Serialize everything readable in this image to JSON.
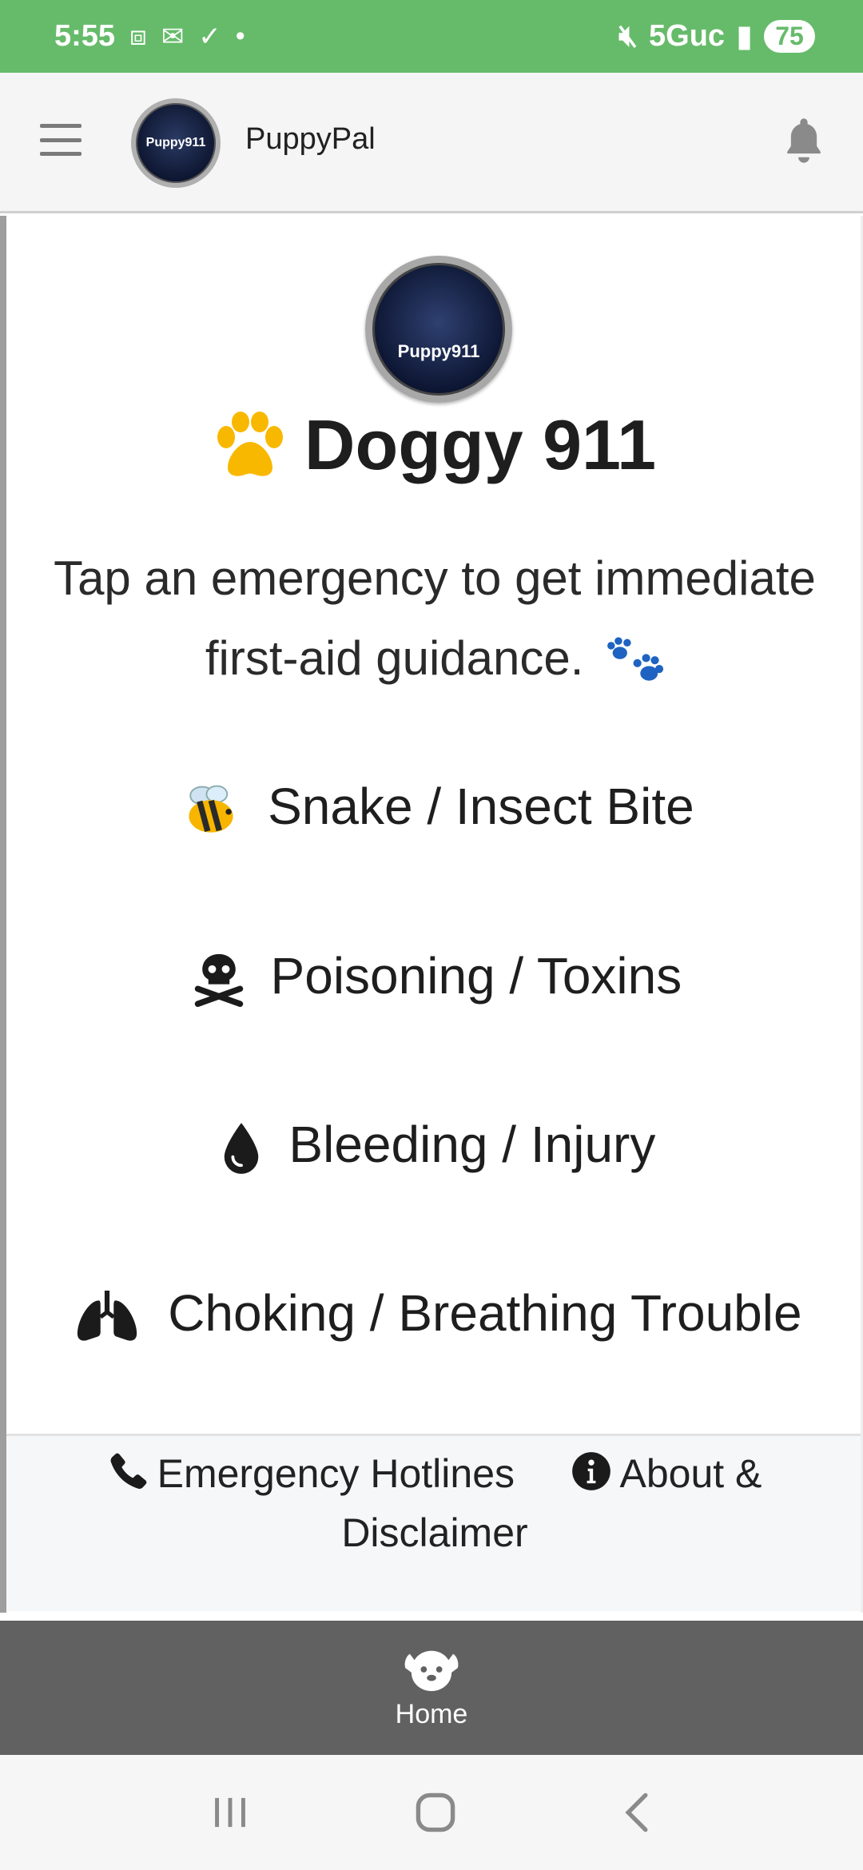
{
  "status_bar": {
    "time": "5:55",
    "network": "5Guc",
    "battery": "75",
    "icons": [
      "screenshot-icon",
      "missed-call-icon",
      "check-icon",
      "dot-icon",
      "mute-icon",
      "signal-icon"
    ]
  },
  "app_bar": {
    "title": "PuppyPal",
    "logo_text": "Puppy911"
  },
  "main": {
    "logo_text": "Puppy911",
    "title": "Doggy 911",
    "subtitle": "Tap an emergency to get immediate first-aid guidance.",
    "emergencies": [
      {
        "label": "Snake / Insect Bite",
        "icon": "bee-icon"
      },
      {
        "label": "Poisoning / Toxins",
        "icon": "skull-crossbones-icon"
      },
      {
        "label": "Bleeding / Injury",
        "icon": "droplet-icon"
      },
      {
        "label": "Choking / Breathing Trouble",
        "icon": "lungs-icon"
      }
    ]
  },
  "links": {
    "hotlines": "Emergency Hotlines",
    "about": "About & Disclaimer"
  },
  "bottom_nav": {
    "home": "Home"
  },
  "colors": {
    "status_bar": "#66bb6a",
    "nav_bar": "#616161",
    "paw_gold": "#f9b800",
    "paw_blue": "#1e63c2"
  }
}
